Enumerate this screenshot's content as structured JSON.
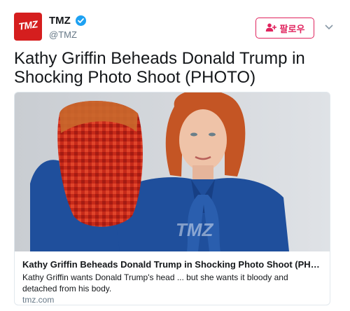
{
  "account": {
    "name": "TMZ",
    "handle": "@TMZ",
    "avatar_text": "TMZ",
    "verified": true
  },
  "follow_button": {
    "label": "팔로우"
  },
  "tweet": {
    "text": "Kathy Griffin Beheads Donald Trump in Shocking Photo Shoot (PHOTO)"
  },
  "card": {
    "title": "Kathy Griffin Beheads Donald Trump in Shocking Photo Shoot (PHOTO + Vi...",
    "description": "Kathy Griffin wants Donald Trump's head ... but she wants it bloody and detached from his body.",
    "domain": "tmz.com",
    "image_watermark": "TMZ"
  },
  "colors": {
    "accent": "#e0245e",
    "verified": "#1da1f2",
    "brand": "#d51e1e"
  },
  "icons": [
    "verified-badge-icon",
    "add-user-icon",
    "chevron-down-icon"
  ]
}
